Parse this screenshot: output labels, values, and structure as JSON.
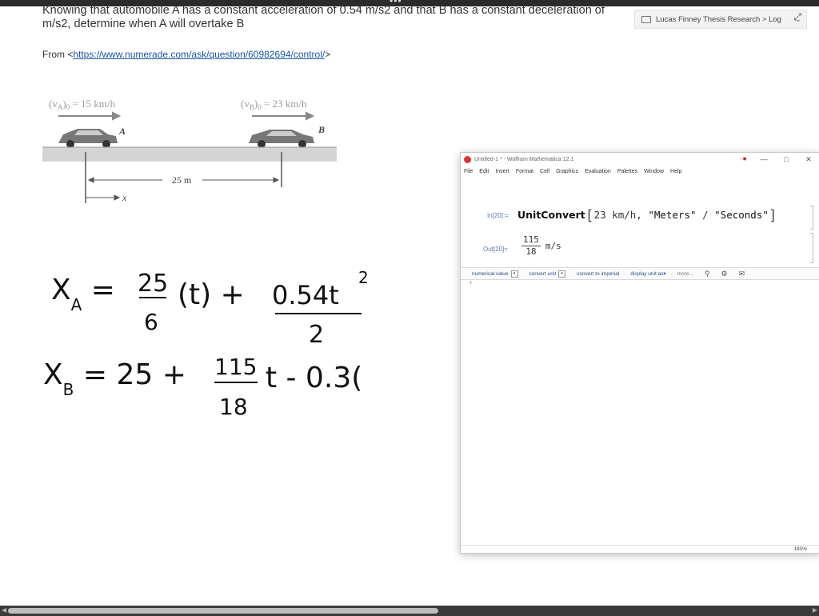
{
  "page": {
    "question_line1": "Knowing that automobile A has a constant acceleration of 0.54 m/s2 and that B has a constant deceleration of",
    "question_line2": "m/s2, determine when A will overtake B",
    "from_label": "From <",
    "from_url": "https://www.numerade.com/ask/question/60982694/control/",
    "from_close": ">"
  },
  "figure": {
    "va_label": "(v_A)_0 = 15 km/h",
    "vb_label": "(v_B)_0 = 23 km/h",
    "car_a": "A",
    "car_b": "B",
    "distance": "25 m",
    "x_axis": "x"
  },
  "handwriting": {
    "xa_equation": "X_A = 25/6 (t) + 0.54t^2/2",
    "xb_equation": "X_B = 25 + 115/18 t - 0.3("
  },
  "notebook_breadcrumb": {
    "text": "Lucas Finney Thesis Research > Log"
  },
  "mathematica": {
    "title": "Untitled-1 * - Wolfram Mathematica 12.1",
    "menu": [
      "File",
      "Edit",
      "Insert",
      "Format",
      "Cell",
      "Graphics",
      "Evaluation",
      "Palettes",
      "Window",
      "Help"
    ],
    "in_label": "In[20]:=",
    "out_label": "Out[20]=",
    "function": "UnitConvert",
    "arg1": "23 km/h",
    "arg2a": "\"Meters\"",
    "arg2b": "\"Seconds\"",
    "out_num": "115",
    "out_den": "18",
    "out_unit": "m/s",
    "suggestions": [
      "numerical value",
      "convert unit",
      "convert to imperial",
      "display unit as",
      "more..."
    ],
    "zoom": "180%"
  }
}
